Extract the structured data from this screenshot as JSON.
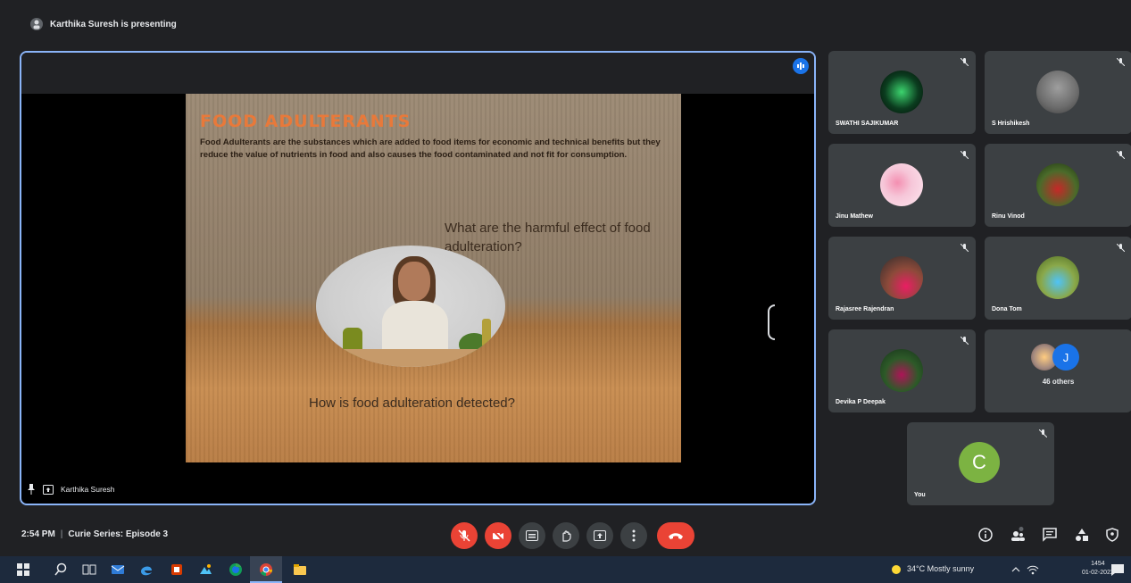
{
  "top_bar": {
    "presenting_text": "Karthika Suresh is presenting"
  },
  "stage": {
    "presenter_name": "Karthika Suresh",
    "slide": {
      "title": "FOOD ADULTERANTS",
      "body": "Food Adulterants are the substances which are added to food items for economic and technical benefits but they reduce the value of nutrients in food and also causes the food contaminated and not fit for consumption.",
      "question_1": "What are the harmful effect of food adulteration?",
      "question_2": "How is food adulteration detected?"
    }
  },
  "participants": [
    {
      "name": "SWATHI SAJIKUMAR",
      "avatar_color": "#0b3d1f"
    },
    {
      "name": "S Hrishikesh",
      "avatar_color": "#6b6b6b"
    },
    {
      "name": "Jinu Mathew",
      "avatar_color": "#f6c6d8"
    },
    {
      "name": "Rinu Vinod",
      "avatar_color": "#4a6b2a"
    },
    {
      "name": "Rajasree Rajendran",
      "avatar_color": "#2c2c2c"
    },
    {
      "name": "Dona Tom",
      "avatar_color": "#8aa84a"
    },
    {
      "name": "Devika P Deepak",
      "avatar_color": "#2d5a28"
    }
  ],
  "others_tile": {
    "label": "46 others",
    "initial": "J"
  },
  "self_tile": {
    "name": "You",
    "initial": "C"
  },
  "bottom_bar": {
    "time": "2:54 PM",
    "meeting_title": "Curie Series: Episode 3"
  },
  "taskbar": {
    "weather": "34°C  Mostly sunny",
    "clock_time": "1454",
    "clock_date": "01-02-2022"
  },
  "colors": {
    "accent": "#8ab4f8",
    "danger": "#ea4335",
    "self_avatar": "#7cb342",
    "others_avatar": "#1a73e8"
  }
}
